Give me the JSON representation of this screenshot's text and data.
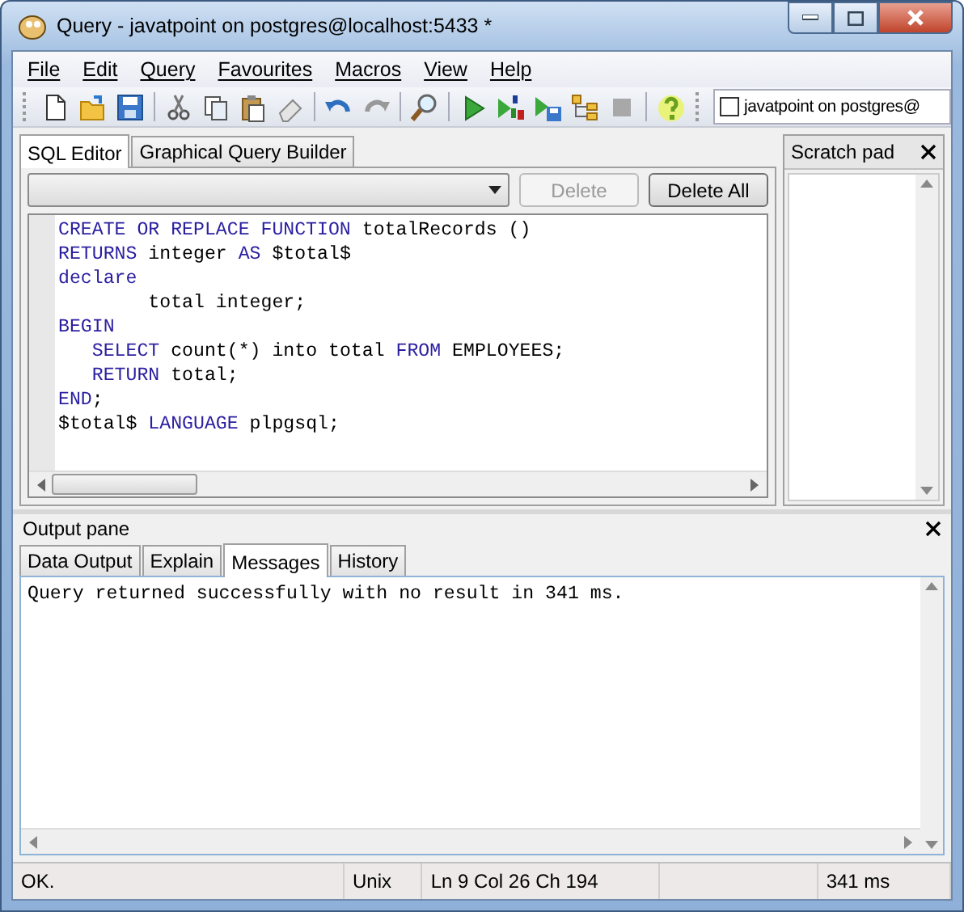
{
  "window": {
    "title": "Query - javatpoint on postgres@localhost:5433 *"
  },
  "menu": [
    "File",
    "Edit",
    "Query",
    "Favourites",
    "Macros",
    "View",
    "Help"
  ],
  "connection": {
    "checked": false,
    "label": "javatpoint on postgres@"
  },
  "editor_tabs": [
    {
      "label": "SQL Editor",
      "selected": true
    },
    {
      "label": "Graphical Query Builder",
      "selected": false
    }
  ],
  "history_bar": {
    "buttons": [
      {
        "label": "Delete",
        "disabled": true
      },
      {
        "label": "Delete All",
        "disabled": false
      }
    ]
  },
  "code_lines": [
    [
      {
        "text": "CREATE OR REPLACE FUNCTION",
        "kind": "keyword"
      },
      {
        "text": " totalRecords ()",
        "kind": "plain"
      }
    ],
    [
      {
        "text": "RETURNS",
        "kind": "keyword"
      },
      {
        "text": " integer ",
        "kind": "plain"
      },
      {
        "text": "AS",
        "kind": "keyword"
      },
      {
        "text": " $total$",
        "kind": "plain"
      }
    ],
    [
      {
        "text": "declare",
        "kind": "keyword"
      }
    ],
    [
      {
        "text": "        total integer;",
        "kind": "plain"
      }
    ],
    [
      {
        "text": "BEGIN",
        "kind": "keyword"
      }
    ],
    [
      {
        "text": "   SELECT",
        "kind": "keyword"
      },
      {
        "text": " count(*) into total ",
        "kind": "plain"
      },
      {
        "text": "FROM",
        "kind": "keyword"
      },
      {
        "text": " EMPLOYEES;",
        "kind": "plain"
      }
    ],
    [
      {
        "text": "   RETURN",
        "kind": "keyword"
      },
      {
        "text": " total;",
        "kind": "plain"
      }
    ],
    [
      {
        "text": "END",
        "kind": "keyword"
      },
      {
        "text": ";",
        "kind": "plain"
      }
    ],
    [
      {
        "text": "$total$ ",
        "kind": "plain"
      },
      {
        "text": "LANGUAGE",
        "kind": "keyword"
      },
      {
        "text": " plpgsql;",
        "kind": "plain"
      }
    ]
  ],
  "scratch_pad": {
    "title": "Scratch pad"
  },
  "output_pane": {
    "title": "Output pane",
    "tabs": [
      {
        "label": "Data Output",
        "selected": false
      },
      {
        "label": "Explain",
        "selected": false
      },
      {
        "label": "Messages",
        "selected": true
      },
      {
        "label": "History",
        "selected": false
      }
    ],
    "message": "Query returned successfully with no result in 341 ms."
  },
  "status_bar": [
    "OK.",
    "Unix",
    "Ln 9 Col 26 Ch 194",
    "341 ms"
  ]
}
